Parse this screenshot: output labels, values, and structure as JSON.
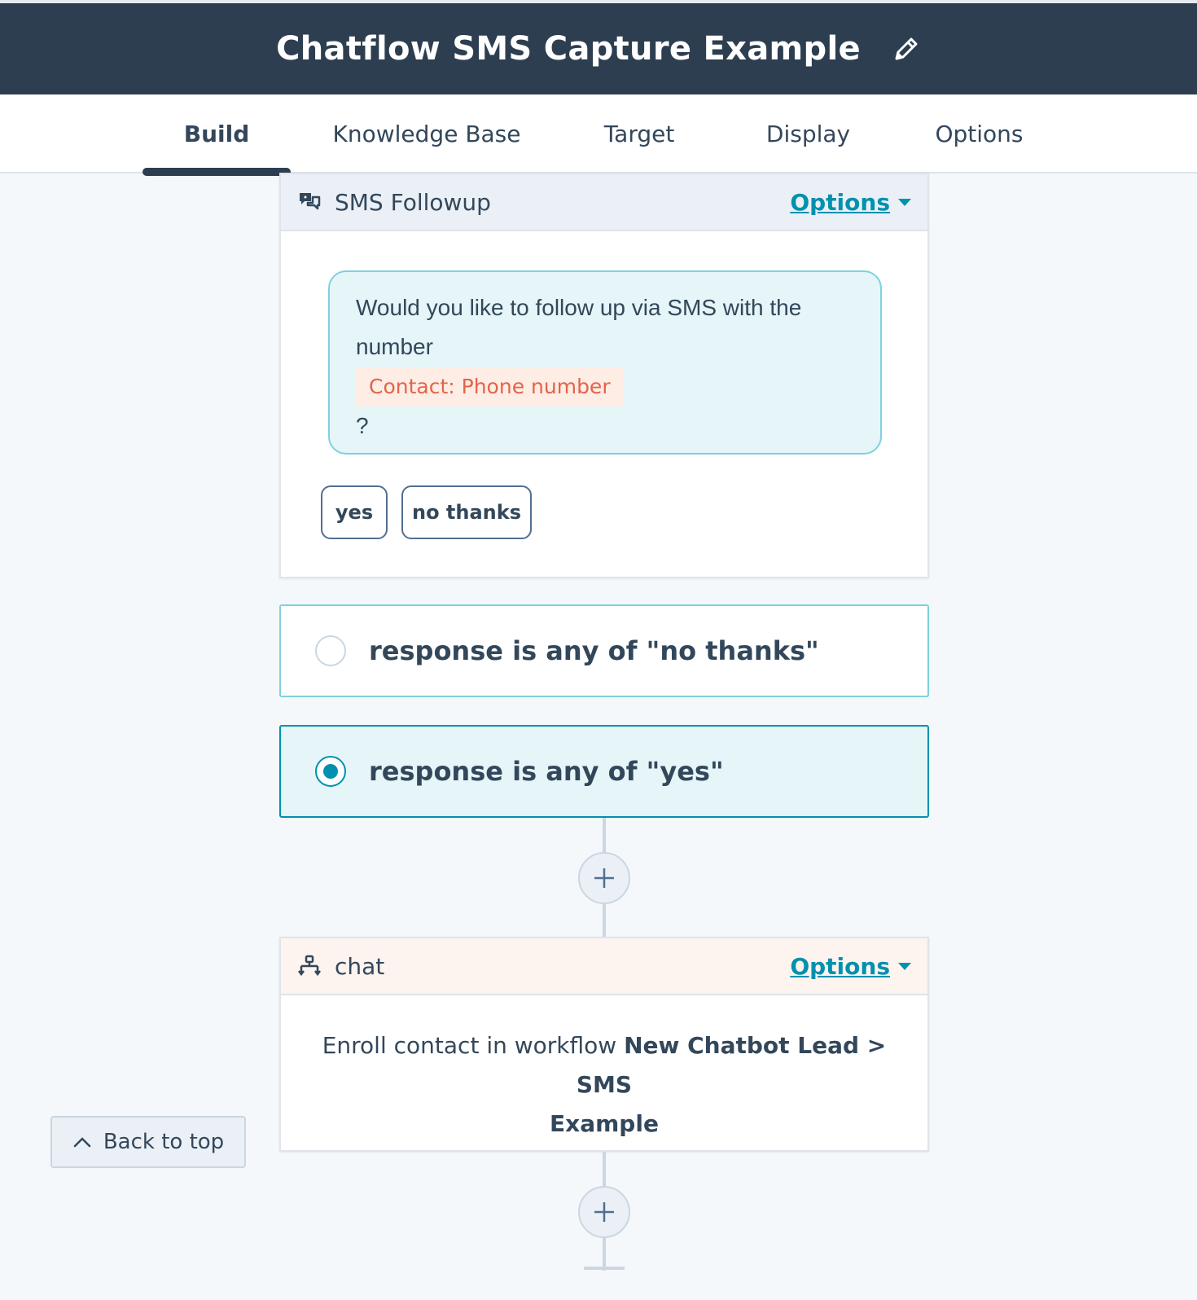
{
  "header": {
    "title": "Chatflow SMS Capture Example",
    "edit_icon": "pencil-icon"
  },
  "tabs": [
    {
      "label": "Build",
      "active": true
    },
    {
      "label": "Knowledge Base",
      "active": false
    },
    {
      "label": "Target",
      "active": false
    },
    {
      "label": "Display",
      "active": false
    },
    {
      "label": "Options",
      "active": false
    }
  ],
  "sms_card": {
    "title": "SMS Followup",
    "icon": "chat-bubbles-icon",
    "options_label": "Options",
    "message_line1": "Would you like to follow up via SMS with the",
    "message_line2": "number",
    "token": "Contact: Phone number",
    "message_end": "?",
    "quick_replies": [
      "yes",
      "no thanks"
    ]
  },
  "branches": [
    {
      "label": "response is any of \"no thanks\"",
      "selected": false
    },
    {
      "label": "response is any of \"yes\"",
      "selected": true
    }
  ],
  "chat_card": {
    "title": "chat",
    "icon": "workflow-icon",
    "options_label": "Options",
    "text_prefix": "Enroll contact in workflow ",
    "workflow_name_line1": "New Chatbot Lead > SMS",
    "workflow_name_line2": "Example"
  },
  "back_to_top": "Back to top",
  "colors": {
    "header_bg": "#2d3e50",
    "link": "#0091ae",
    "bubble_bg": "#e5f5f8",
    "token_bg": "#fdede4",
    "selected_branch_bg": "#e5f5f8",
    "chat_head_bg": "#fdf3ef"
  }
}
